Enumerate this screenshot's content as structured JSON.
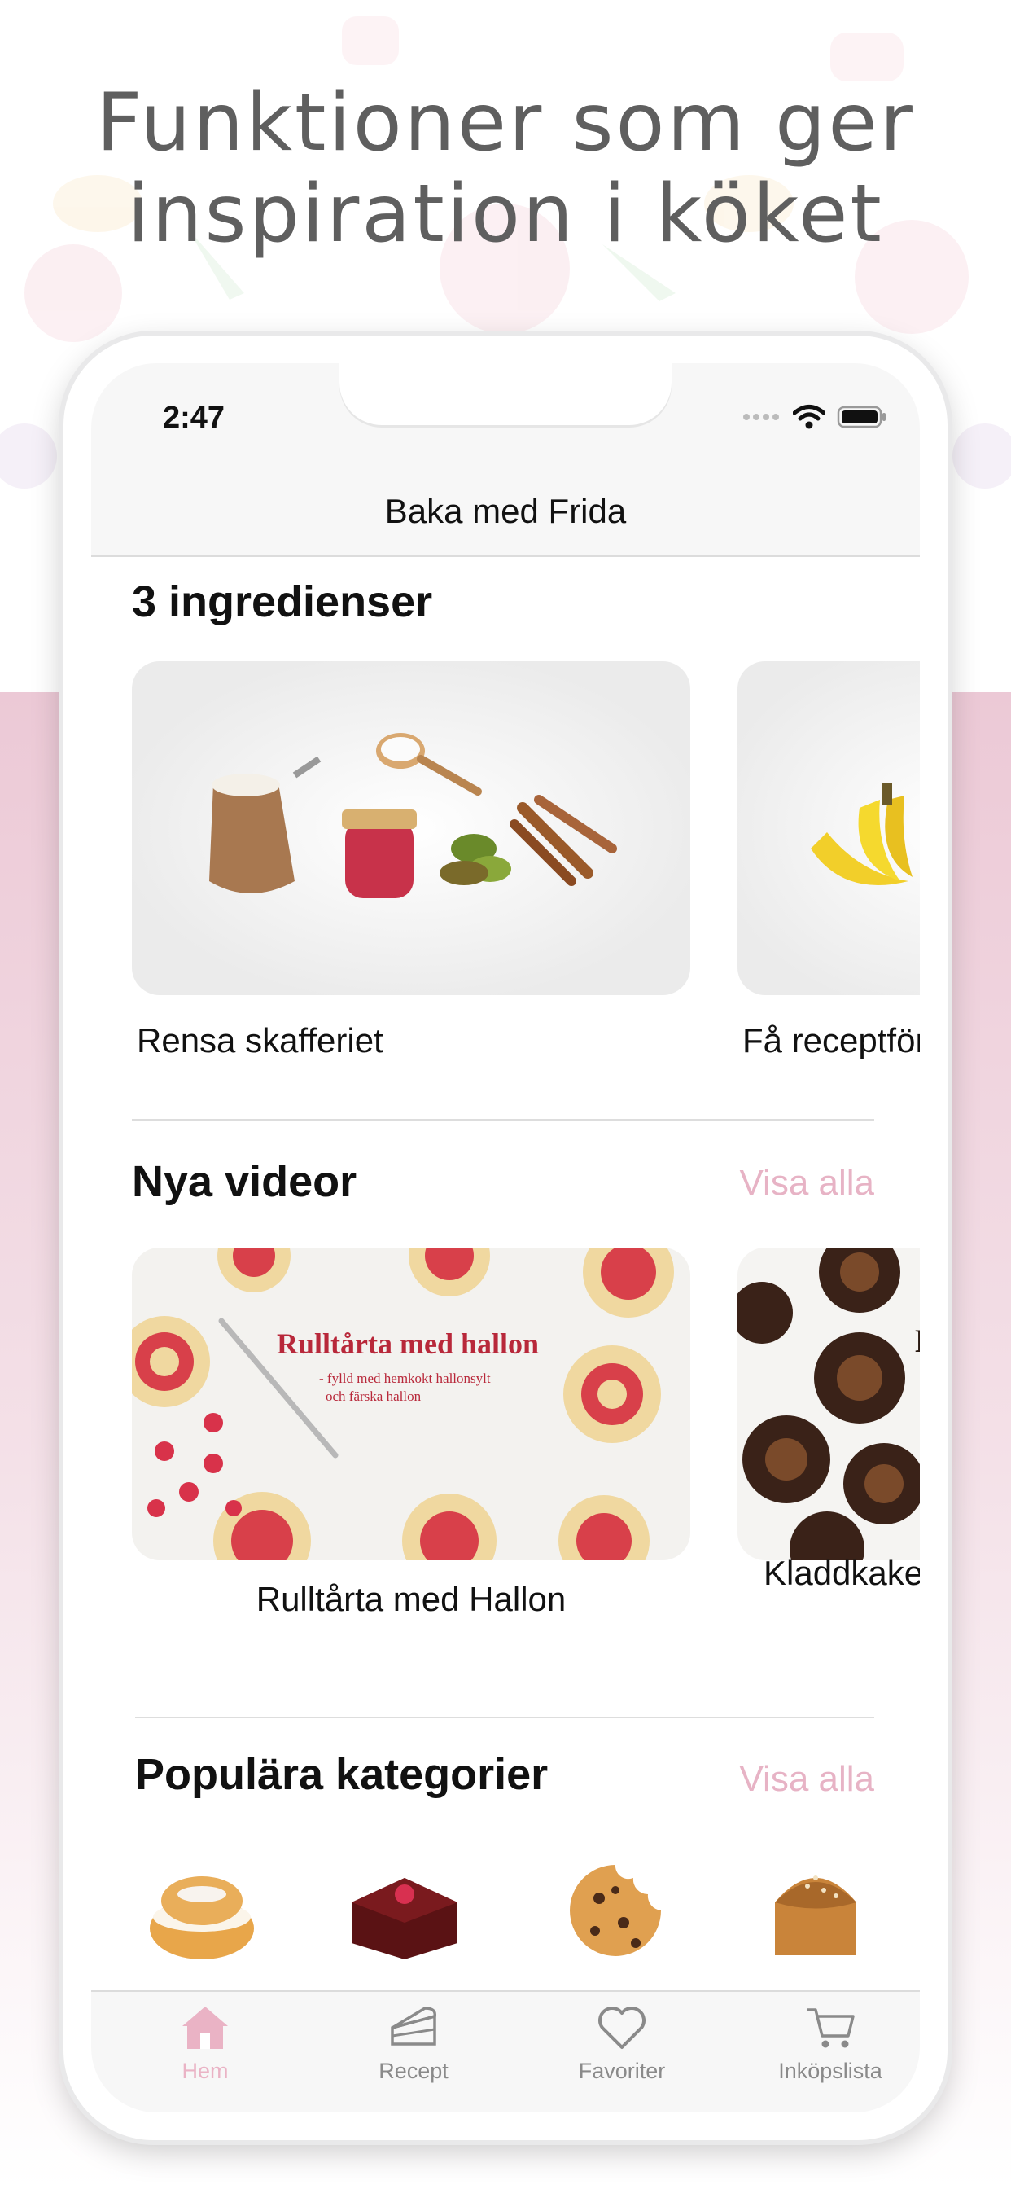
{
  "headline": {
    "line1": "Funktioner som ger",
    "line2": "inspiration i köket"
  },
  "status_bar": {
    "time": "2:47",
    "icons": [
      "signal-dots-icon",
      "wifi-icon",
      "battery-icon"
    ]
  },
  "nav": {
    "title": "Baka med Frida"
  },
  "section_ingredients": {
    "title": "3 ingredienser",
    "cards": [
      {
        "label": "Rensa skafferiet",
        "image": "pantry-ingredients-image"
      },
      {
        "label": "Få receptför",
        "image": "bananas-image"
      }
    ]
  },
  "section_videos": {
    "title": "Nya videor",
    "see_all": "Visa alla",
    "cards": [
      {
        "label": "Rulltårta med Hallon",
        "thumb_title": "Rulltårta med hallon",
        "thumb_subtitle_1": "- fylld med hemkokt hallonsylt",
        "thumb_subtitle_2": "och färska hallon"
      },
      {
        "label": "Kladdkake",
        "thumb_title": "Kl"
      }
    ]
  },
  "section_categories": {
    "title": "Populära kategorier",
    "see_all": "Visa alla",
    "items": [
      "semla-icon",
      "brownie-icon",
      "cookie-icon",
      "bread-icon"
    ]
  },
  "tabbar": {
    "items": [
      {
        "label": "Hem",
        "icon": "home-icon",
        "active": true
      },
      {
        "label": "Recept",
        "icon": "cake-slice-icon",
        "active": false
      },
      {
        "label": "Favoriter",
        "icon": "heart-icon",
        "active": false
      },
      {
        "label": "Inköpslista",
        "icon": "cart-icon",
        "active": false
      }
    ]
  },
  "colors": {
    "accent_pink": "#eab3c5",
    "headline_gray": "#5f5f5f",
    "bg_pink": "#ecc9d6"
  }
}
